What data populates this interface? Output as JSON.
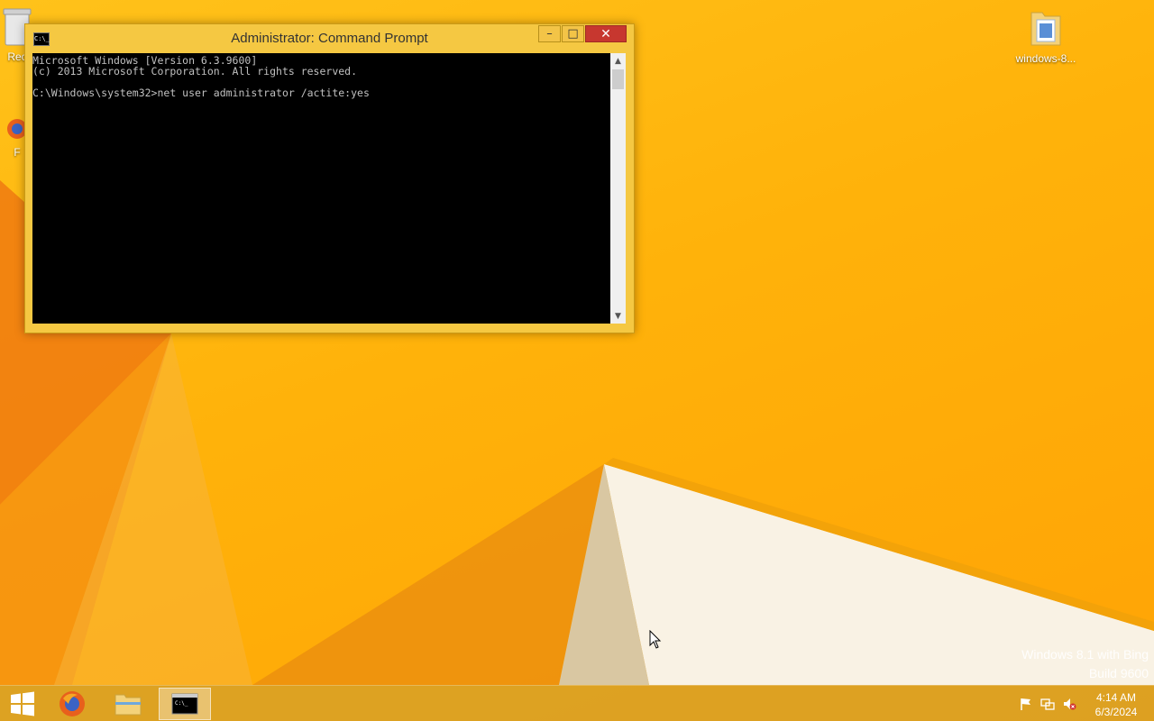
{
  "window": {
    "title": "Administrator: Command Prompt",
    "app_icon_label": "C:\\_",
    "controls": {
      "minimize": "–",
      "maximize": "□",
      "close": "✕"
    }
  },
  "console": {
    "lines": [
      "Microsoft Windows [Version 6.3.9600]",
      "(c) 2013 Microsoft Corporation. All rights reserved.",
      "",
      "C:\\Windows\\system32>net user administrator /actite:yes"
    ]
  },
  "desktop_icons": {
    "recycle_bin_label": "Rec",
    "firefox_label": "F",
    "folder_label": "windows-8..."
  },
  "watermark": {
    "line1": "Windows 8.1 with Bing",
    "line2": "Build 9600"
  },
  "taskbar": {
    "items": [
      "start-icon",
      "firefox-icon",
      "file-explorer-icon",
      "command-prompt-icon"
    ],
    "tray_icons": [
      "flag-icon",
      "network-icon",
      "volume-muted-icon"
    ],
    "clock_time": "4:14 AM",
    "clock_date": "6/3/2024"
  },
  "theme": {
    "wallpaper_primary": "#ffb60f",
    "title_bar": "#f5c842",
    "close_button": "#c7372f",
    "console_bg": "#000000",
    "console_fg": "#c0c0c0"
  }
}
